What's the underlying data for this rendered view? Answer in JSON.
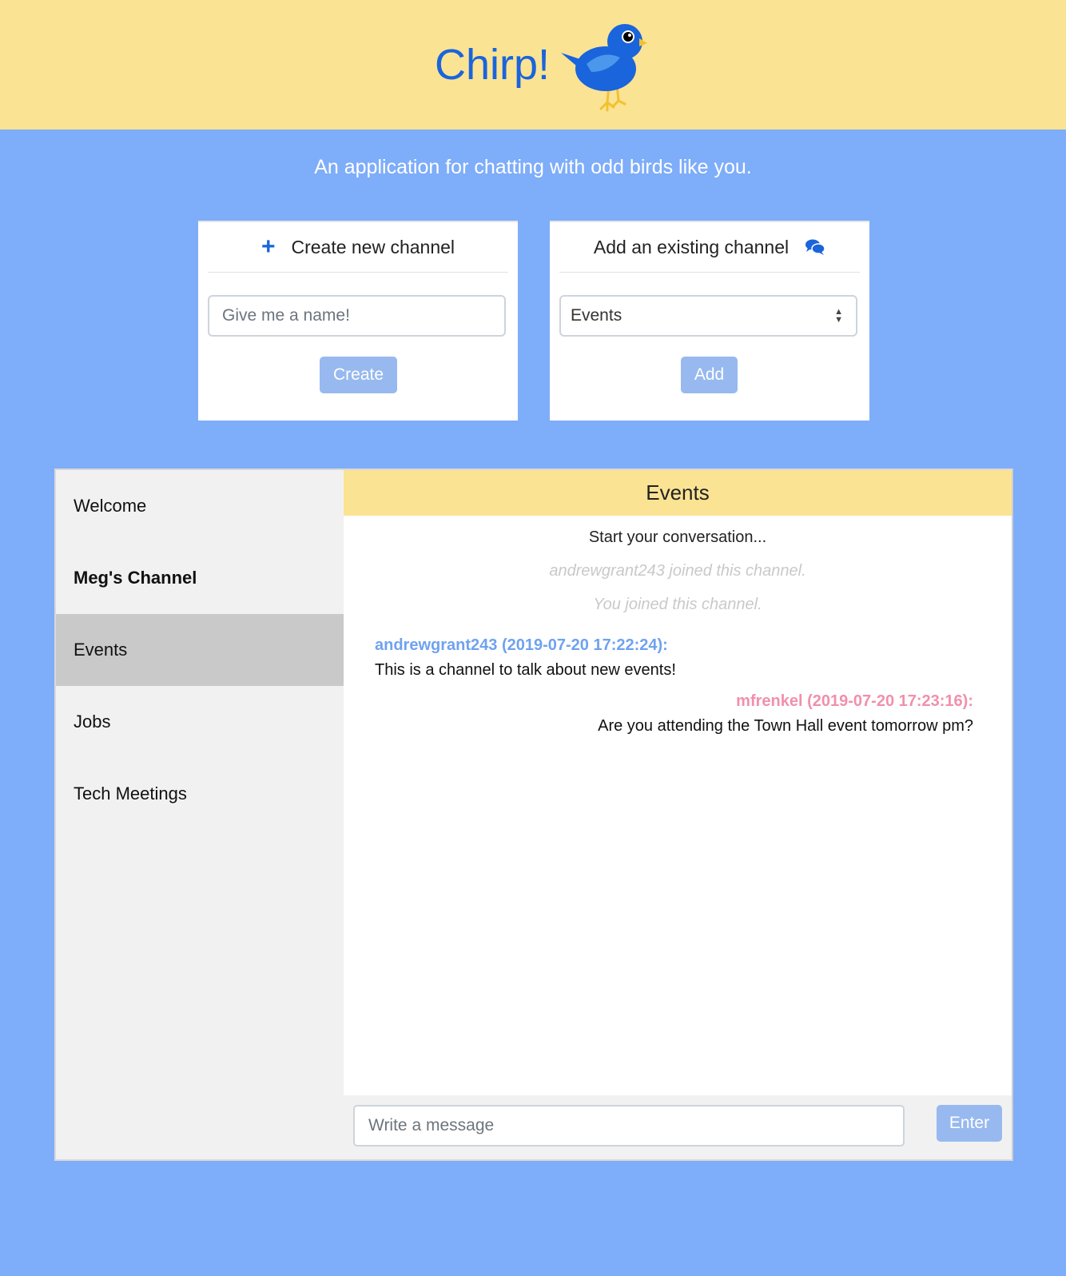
{
  "header": {
    "title": "Chirp!"
  },
  "tagline": "An application for chatting with odd birds like you.",
  "create_card": {
    "title": "Create new channel",
    "input_placeholder": "Give me a name!",
    "button_label": "Create"
  },
  "add_card": {
    "title": "Add an existing channel",
    "selected_option": "Events",
    "button_label": "Add"
  },
  "sidebar": {
    "items": [
      {
        "label": "Welcome"
      },
      {
        "label": "Meg's Channel"
      },
      {
        "label": "Events"
      },
      {
        "label": "Jobs"
      },
      {
        "label": "Tech Meetings"
      }
    ]
  },
  "channel": {
    "title": "Events",
    "start_text": "Start your conversation...",
    "notices": [
      "andrewgrant243 joined this channel.",
      "You joined this channel."
    ],
    "messages": [
      {
        "author": "andrewgrant243 (2019-07-20 17:22:24):",
        "body": "This is a channel to talk about new events!"
      },
      {
        "author": "mfrenkel (2019-07-20 17:23:16):",
        "body": "Are you attending the Town Hall event tomorrow pm?"
      }
    ]
  },
  "compose": {
    "placeholder": "Write a message",
    "button_label": "Enter"
  },
  "colors": {
    "page_background": "#7eadf9",
    "header_background": "#fbe394",
    "brand_blue": "#1a64dc",
    "button": "#97b9ef",
    "author_left": "#6fa2f0",
    "author_right": "#f190ab"
  }
}
